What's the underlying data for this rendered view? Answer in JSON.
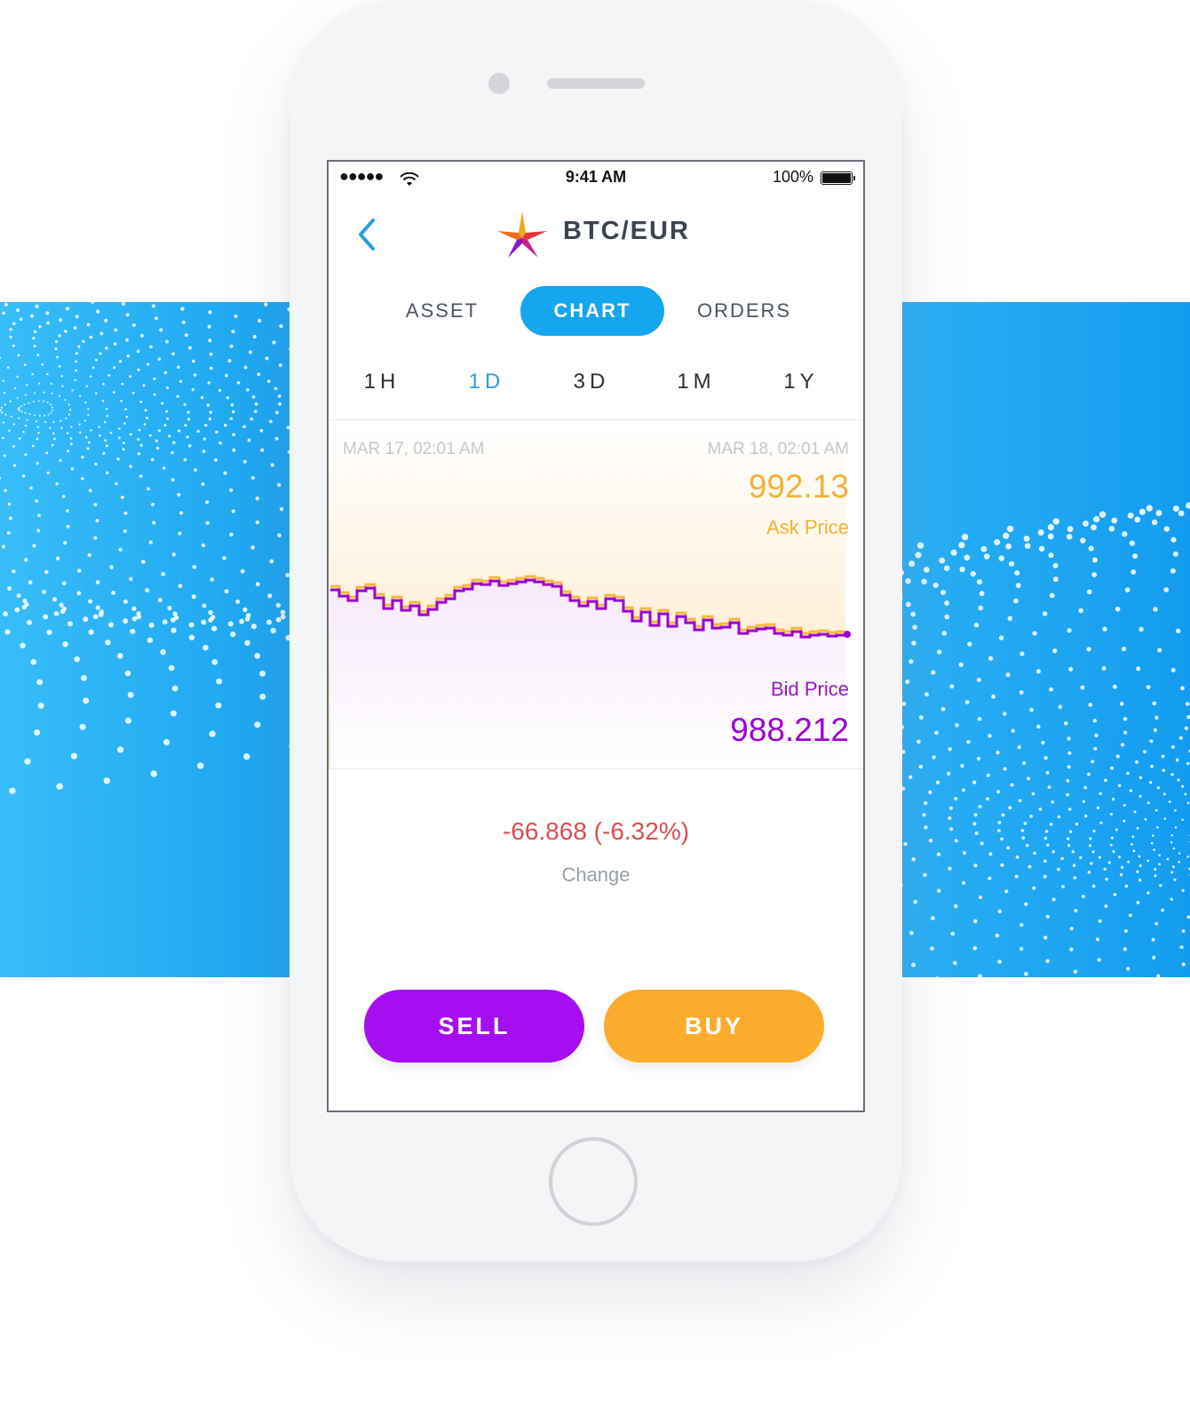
{
  "status_bar": {
    "signal": "●●●●●",
    "time": "9:41 AM",
    "battery": "100%",
    "icons": [
      "wifi-icon",
      "battery-icon"
    ]
  },
  "header": {
    "back_icon": "chevron-left-icon",
    "logo_icon": "star-logo-icon",
    "pair": "BTC/EUR"
  },
  "tabs": [
    {
      "label": "ASSET",
      "active": false
    },
    {
      "label": "CHART",
      "active": true
    },
    {
      "label": "ORDERS",
      "active": false
    }
  ],
  "ranges": [
    {
      "label": "1H",
      "active": false
    },
    {
      "label": "1D",
      "active": true
    },
    {
      "label": "3D",
      "active": false
    },
    {
      "label": "1M",
      "active": false
    },
    {
      "label": "1Y",
      "active": false
    }
  ],
  "chart": {
    "start_label": "MAR 17, 02:01 AM",
    "end_label": "MAR 18, 02:01 AM",
    "ask_value": "992.13",
    "ask_label": "Ask Price",
    "bid_label": "Bid Price",
    "bid_value": "988.212"
  },
  "change": {
    "value": "-66.868 (-6.32%)",
    "label": "Change"
  },
  "actions": {
    "sell": "SELL",
    "buy": "BUY"
  },
  "colors": {
    "accent_blue": "#14a6ef",
    "ask_orange": "#f5b033",
    "bid_purple": "#9b00d2",
    "sell_purple": "#a50ef0",
    "buy_orange": "#fcac2c",
    "change_red": "#d94f4f"
  }
}
